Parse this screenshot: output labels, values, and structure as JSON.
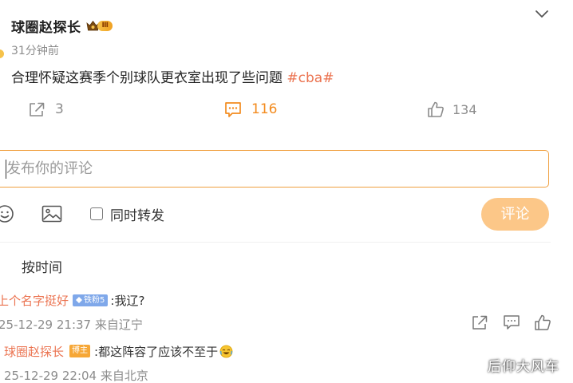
{
  "post": {
    "author": "球圈赵探长",
    "vip_level": "Ⅲ",
    "time": "31分钟前",
    "text": "合理怀疑这赛季个别球队更衣室出现了些问题 ",
    "hashtag": "#cba#"
  },
  "actions": {
    "repost_count": "3",
    "comment_count": "116",
    "like_count": "134"
  },
  "composer": {
    "placeholder": "发布你的评论",
    "forward_label": "同时转发",
    "submit_label": "评论"
  },
  "sort_label": "按时间",
  "comments": [
    {
      "author": "上个名字挺好",
      "badge": "铁粉5",
      "text": ":我辽?",
      "meta": "25-12-29 21:37 来自辽宁"
    },
    {
      "author": "球圈赵探长",
      "badge": "博主",
      "text": ":都这阵容了应该不至于",
      "meta": "25-12-29 22:04 来自北京"
    }
  ],
  "watermark": "后仰大风车",
  "colors": {
    "accent_orange": "#f38b1e",
    "link_orange": "#eb7350",
    "input_border": "#f0a040",
    "submit_disabled": "#fcc788",
    "muted_text": "#8c8c8c"
  },
  "icons": [
    "crown-icon",
    "chevron-down-icon",
    "repost-icon",
    "comment-icon",
    "like-icon",
    "emoji-icon",
    "image-icon",
    "diamond-icon",
    "laugh-emoji-icon",
    "share-icon"
  ]
}
